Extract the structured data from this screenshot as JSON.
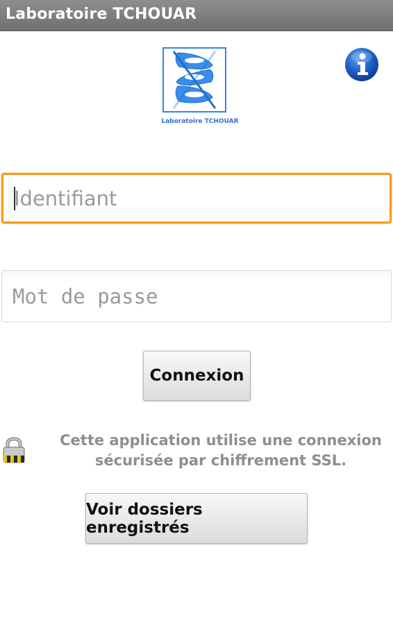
{
  "app": {
    "title": "Laboratoire TCHOUAR"
  },
  "logo": {
    "caption": "Laboratoire TCHOUAR",
    "icon": "dna-helix-logo"
  },
  "info": {
    "icon": "info-icon",
    "color": "#1d5fc4"
  },
  "form": {
    "identifiant_placeholder": "Identifiant",
    "password_placeholder": "Mot de passe",
    "login_label": "Connexion"
  },
  "security": {
    "icon": "lock-icon",
    "message_line1": "Cette application utilise une connexion",
    "message_line2": "sécurisée par chiffrement SSL."
  },
  "saved": {
    "button_label": "Voir dossiers enregistrés"
  },
  "colors": {
    "focus_border": "#f59a1e",
    "logo_blue": "#2f86e8",
    "title_bar": "#7a7a7a"
  }
}
